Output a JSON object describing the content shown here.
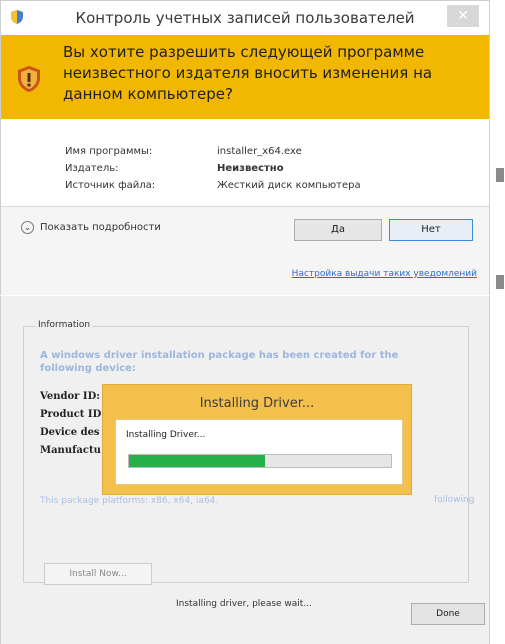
{
  "uac": {
    "title": "Контроль учетных записей пользователей",
    "close_label": "✕",
    "question": "Вы хотите разрешить следующей программе неизвестного издателя вносить изменения на данном компьютере?",
    "info": [
      {
        "label": "Имя программы:",
        "value": "installer_x64.exe",
        "bold": false
      },
      {
        "label": "Издатель:",
        "value": "Неизвестно",
        "bold": true
      },
      {
        "label": "Источник файла:",
        "value": "Жесткий диск компьютера",
        "bold": false
      }
    ],
    "details_label": "Показать подробности",
    "yes_label": "Да",
    "no_label": "Нет",
    "settings_link": "Настройка выдачи таких уведомлений",
    "colors": {
      "banner": "#f2b700",
      "link": "#2a6ec9"
    }
  },
  "installer": {
    "group_title": "Information",
    "description": "A windows driver installation package has been created for the following device:",
    "fields": [
      "Vendor ID:",
      "Product ID",
      "Device des",
      "Manufactu"
    ],
    "platforms_text": "This package platforms: x86, x64, ia64.",
    "platforms_right": "following",
    "install_button": "Install Now...",
    "status": "Installing driver, please wait...",
    "done_button": "Done"
  },
  "progress": {
    "title": "Installing Driver...",
    "label": "Installing Driver...",
    "fraction": 0.52,
    "color": "#26b04a"
  }
}
